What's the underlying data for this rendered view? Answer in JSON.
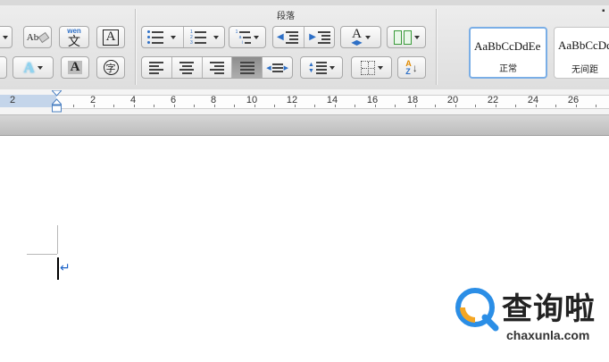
{
  "ribbon": {
    "paragraph_group_title": "段落",
    "font_buttons": {
      "phonetic_label": "wen",
      "phonetic_char": "文",
      "boxed_char": "A",
      "text_effect_char": "A",
      "shaded_char": "A",
      "enclosed_char": "字",
      "spelling_label": "Ab"
    },
    "icons": {
      "bullets": "bullet-list-icon",
      "numbering": "numbered-list-icon",
      "multilevel": "multilevel-list-icon",
      "decrease_indent": "decrease-indent-icon",
      "increase_indent": "increase-indent-icon",
      "text_direction": "text-direction-icon",
      "columns": "columns-icon",
      "align_left": "align-left-icon",
      "align_center": "align-center-icon",
      "align_right": "align-right-icon",
      "justify": "justify-icon",
      "distributed": "distributed-icon",
      "line_spacing": "line-spacing-icon",
      "borders": "borders-icon",
      "sort": "sort-icon"
    },
    "styles": [
      {
        "sample": "AaBbCcDdEe",
        "name": "正常",
        "selected": true
      },
      {
        "sample": "AaBbCcDd",
        "name": "无间距",
        "selected": false
      }
    ]
  },
  "ruler": {
    "numbers": [
      "2",
      "2",
      "2",
      "4",
      "6",
      "8",
      "10",
      "12",
      "14",
      "16",
      "18",
      "20",
      "22",
      "24",
      "26"
    ]
  },
  "document": {
    "paragraph_mark": "↵"
  },
  "watermark": {
    "title": "查询啦",
    "url": "chaxunla.com"
  },
  "colors": {
    "accent_blue": "#2d6fc6",
    "paragraph_mark": "#1e64c8",
    "ruler_margin": "#c4d5ea",
    "watermark_blue": "#2b8ee6",
    "watermark_orange": "#f5a623"
  }
}
